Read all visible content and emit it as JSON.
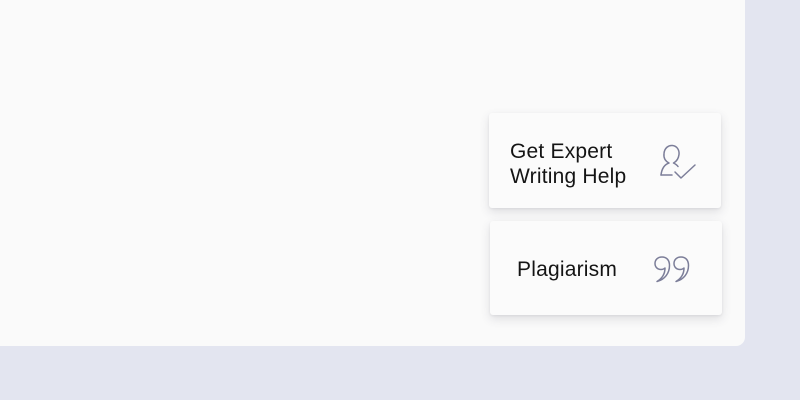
{
  "cards": {
    "writing_help": {
      "line1": "Get Expert",
      "line2": "Writing Help",
      "icon": "user-check-icon"
    },
    "plagiarism": {
      "label": "Plagiarism",
      "icon": "quote-icon"
    }
  },
  "colors": {
    "page_background": "#e3e5f0",
    "panel_background": "#fafafa",
    "card_background": "#fbfbfb",
    "text": "#141414",
    "icon_stroke": "#7c7e99"
  }
}
